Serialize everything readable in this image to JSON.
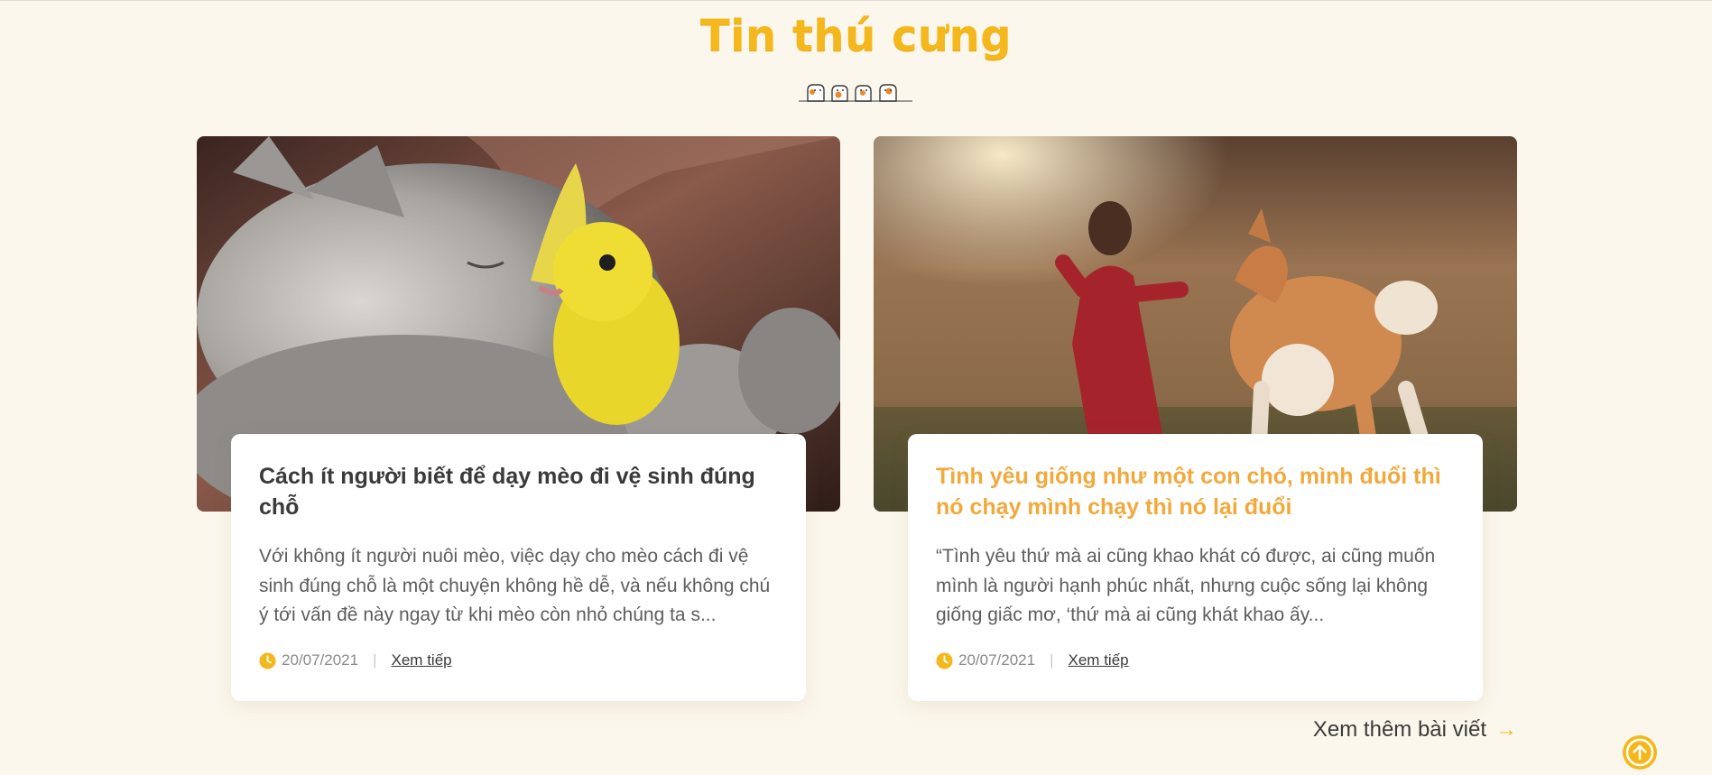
{
  "section": {
    "title": "Tin thú cưng"
  },
  "posts": [
    {
      "title": "Cách ít người biết để dạy mèo đi vệ sinh đúng chỗ",
      "excerpt": "Với không ít người nuôi mèo, việc dạy cho mèo cách đi vệ sinh đúng chỗ là một chuyện không hề dễ, và nếu không chú ý tới vấn đề này ngay từ khi mèo còn nhỏ chúng ta s...",
      "date": "20/07/2021",
      "read_more": "Xem tiếp",
      "image": "kitten-with-yellow-bunny-photo"
    },
    {
      "title": "Tình yêu giống như một con chó, mình đuổi thì nó chạy mình chạy thì nó lại đuổi",
      "excerpt": "“Tình yêu thứ mà ai cũng khao khát có được, ai cũng muốn mình là người hạnh phúc nhất, nhưng cuộc sống lại không giống giấc mơ, ‘thứ mà ai cũng khát khao ấy...",
      "date": "20/07/2021",
      "read_more": "Xem tiếp",
      "image": "girl-running-with-shiba-photo"
    }
  ],
  "footer": {
    "see_more": "Xem thêm bài viết",
    "arrow": "→"
  },
  "colors": {
    "accent": "#f5b81c",
    "title_accent": "#f2a93b",
    "background": "#fcf7ec"
  },
  "icons": {
    "clock": "clock-icon",
    "back_to_top": "arrow-up-circle-icon",
    "decoration": "pets-row-icon"
  }
}
